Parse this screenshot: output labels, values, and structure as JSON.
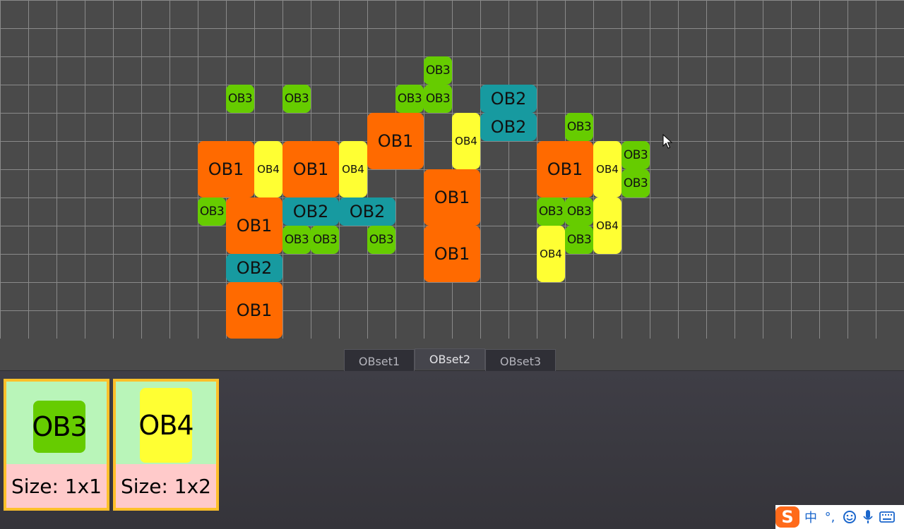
{
  "colors": {
    "ob1": "#ff6a00",
    "ob2": "#179aa0",
    "ob3": "#66cc00",
    "ob4": "#ffff33",
    "card_border": "#ffc02a",
    "card_top": "#b9f5b9",
    "card_bottom": "#ffcaca"
  },
  "labels": {
    "ob1": "OB1",
    "ob2": "OB2",
    "ob3": "OB3",
    "ob4": "OB4"
  },
  "tabs": [
    {
      "label": "OBset1",
      "active": false
    },
    {
      "label": "OBset2",
      "active": true
    },
    {
      "label": "OBset3",
      "active": false
    }
  ],
  "palette": [
    {
      "label": "OB3",
      "size": "Size: 1x1",
      "icon": "ob3"
    },
    {
      "label": "OB4",
      "size": "Size: 1x2",
      "icon": "ob4"
    }
  ],
  "tray": {
    "logo": "S",
    "lang": "中",
    "punct": "°,",
    "icons": [
      "emoji-icon",
      "microphone-icon",
      "keyboard-icon"
    ]
  }
}
